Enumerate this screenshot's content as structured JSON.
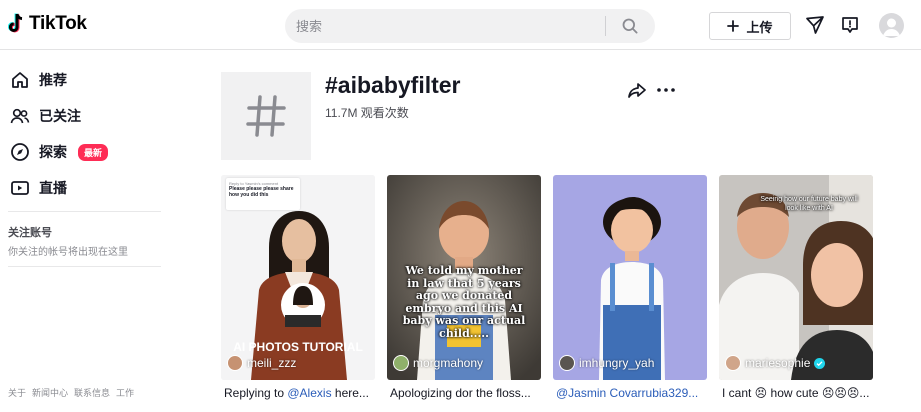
{
  "header": {
    "logo_text": "TikTok",
    "search_placeholder": "搜索",
    "upload_label": "上传"
  },
  "sidebar": {
    "nav": [
      {
        "label": "推荐",
        "icon": "home-icon"
      },
      {
        "label": "已关注",
        "icon": "following-icon"
      },
      {
        "label": "探索",
        "icon": "compass-icon",
        "badge": "最新"
      },
      {
        "label": "直播",
        "icon": "live-icon"
      }
    ],
    "following_heading": "关注账号",
    "following_note": "你关注的帐号将出现在这里",
    "footer_links": [
      "关于",
      "新闻中心",
      "联系信息",
      "工作"
    ]
  },
  "tag": {
    "title": "#aibabyfilter",
    "views": "11.7M 观看次数"
  },
  "videos": [
    {
      "username": "meili_zzz",
      "comment_reply": "Reply to Yasmin's comment",
      "comment_text": "Please please please share how you did this",
      "overlay": "AI PHOTOS TUTORIAL",
      "caption_pre": "Replying to ",
      "caption_mention": "@Alexis",
      "caption_post": " here..."
    },
    {
      "username": "morgmahony",
      "overlay": "We told my mother in law that 5 years ago we donated embryo and this AI baby was our actual child.....",
      "caption_pre": "Apologizing dor the floss...",
      "caption_mention": "",
      "caption_post": ""
    },
    {
      "username": "imhungry_yah",
      "caption_pre": "",
      "caption_mention": "@Jasmin Covarrubia329...",
      "caption_post": ""
    },
    {
      "username": "mariesophie",
      "verified": true,
      "overlay": "Seeing how our future baby will look like with AI",
      "caption_pre": "I cant 😣 how cute 😣😣😣...",
      "caption_mention": "",
      "caption_post": ""
    }
  ]
}
